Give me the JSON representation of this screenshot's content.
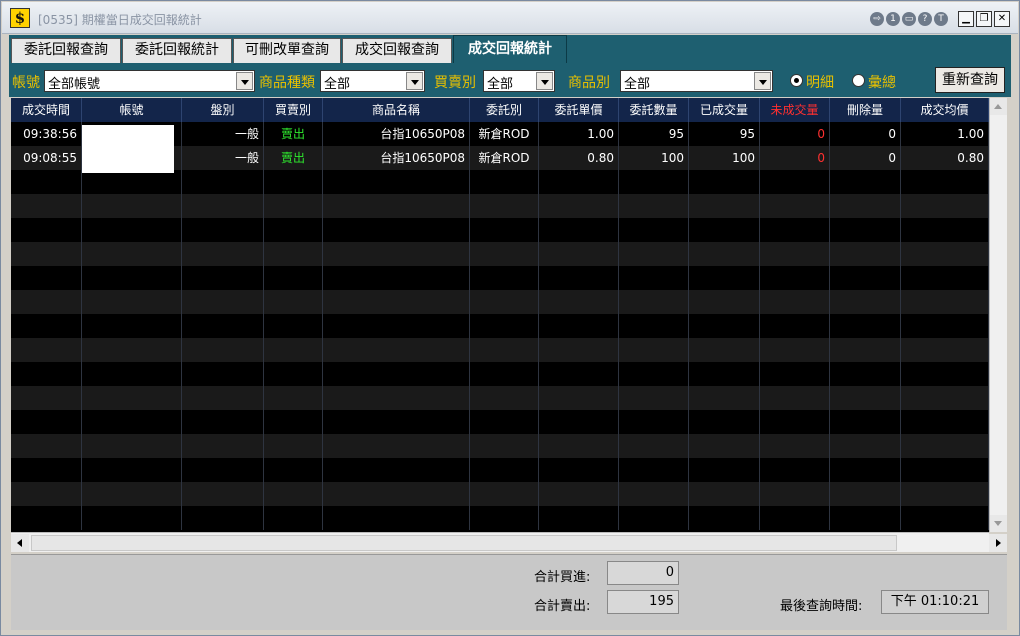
{
  "window": {
    "title": "[0535] 期權當日成交回報統計",
    "logo": "$"
  },
  "title_buttons": [
    "1",
    "?",
    "T"
  ],
  "tabs": [
    {
      "label": "委託回報查詢",
      "active": false
    },
    {
      "label": "委託回報統計",
      "active": false
    },
    {
      "label": "可刪改單查詢",
      "active": false
    },
    {
      "label": "成交回報查詢",
      "active": false
    },
    {
      "label": "成交回報統計",
      "active": true
    }
  ],
  "filters": {
    "account_label": "帳號",
    "account_value": "全部帳號",
    "product_type_label": "商品種類",
    "product_type_value": "全部",
    "side_label": "買賣別",
    "side_value": "全部",
    "product_label": "商品別",
    "product_value": "全部",
    "detail_label": "明細",
    "summary_label": "彙總",
    "requery_label": "重新查詢"
  },
  "table": {
    "columns": [
      "成交時間",
      "帳號",
      "盤別",
      "買賣別",
      "商品名稱",
      "委託別",
      "委託單價",
      "委託數量",
      "已成交量",
      "未成交量",
      "刪除量",
      "成交均價"
    ],
    "rows": [
      [
        "09:38:56",
        "",
        "一般",
        "賣出",
        "台指10650P08",
        "新倉ROD",
        "1.00",
        "95",
        "95",
        "0",
        "0",
        "1.00"
      ],
      [
        "09:08:55",
        "",
        "一般",
        "賣出",
        "台指10650P08",
        "新倉ROD",
        "0.80",
        "100",
        "100",
        "0",
        "0",
        "0.80"
      ]
    ]
  },
  "footer": {
    "total_buy_label": "合計買進:",
    "total_buy_value": "0",
    "total_sell_label": "合計賣出:",
    "total_sell_value": "195",
    "last_query_label": "最後查詢時間:",
    "last_query_value": "下午  01:10:21"
  },
  "colors": {
    "toolbar_bg": "#1e5f70",
    "label_yellow": "#e8c000",
    "header_bg": "#13254a",
    "sell_green": "#2ee82e",
    "unfilled_red": "#ff3030"
  }
}
